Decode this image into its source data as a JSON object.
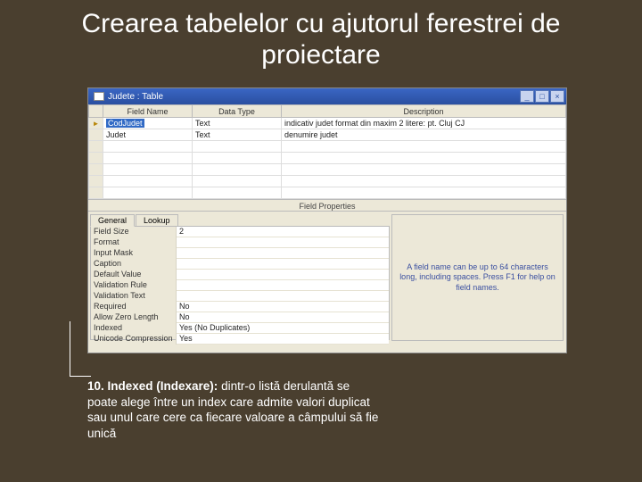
{
  "slide": {
    "title": "Crearea tabelelor cu ajutorul ferestrei de proiectare"
  },
  "window": {
    "title": "Judete : Table",
    "buttons": {
      "min": "_",
      "max": "□",
      "close": "×"
    }
  },
  "grid": {
    "headers": [
      "Field Name",
      "Data Type",
      "Description"
    ],
    "rows": [
      {
        "key": "►",
        "field": "CodJudet",
        "type": "Text",
        "desc": "indicativ judet format din maxim 2 litere: pt. Cluj CJ"
      },
      {
        "key": "",
        "field": "Judet",
        "type": "Text",
        "desc": "denumire judet"
      }
    ]
  },
  "fieldPropsLabel": "Field Properties",
  "tabs": {
    "general": "General",
    "lookup": "Lookup"
  },
  "properties": [
    {
      "label": "Field Size",
      "value": "2"
    },
    {
      "label": "Format",
      "value": ""
    },
    {
      "label": "Input Mask",
      "value": ""
    },
    {
      "label": "Caption",
      "value": ""
    },
    {
      "label": "Default Value",
      "value": ""
    },
    {
      "label": "Validation Rule",
      "value": ""
    },
    {
      "label": "Validation Text",
      "value": ""
    },
    {
      "label": "Required",
      "value": "No"
    },
    {
      "label": "Allow Zero Length",
      "value": "No"
    },
    {
      "label": "Indexed",
      "value": "Yes (No Duplicates)"
    },
    {
      "label": "Unicode Compression",
      "value": "Yes"
    }
  ],
  "helper": "A field name can be up to 64 characters long, including spaces. Press F1 for help on field names.",
  "caption": {
    "lead": "10. Indexed (Indexare):",
    "rest": " dintr-o listă derulantă se poate alege între un index care admite valori duplicat sau unul care cere ca fiecare valoare a câmpului să fie unică"
  }
}
